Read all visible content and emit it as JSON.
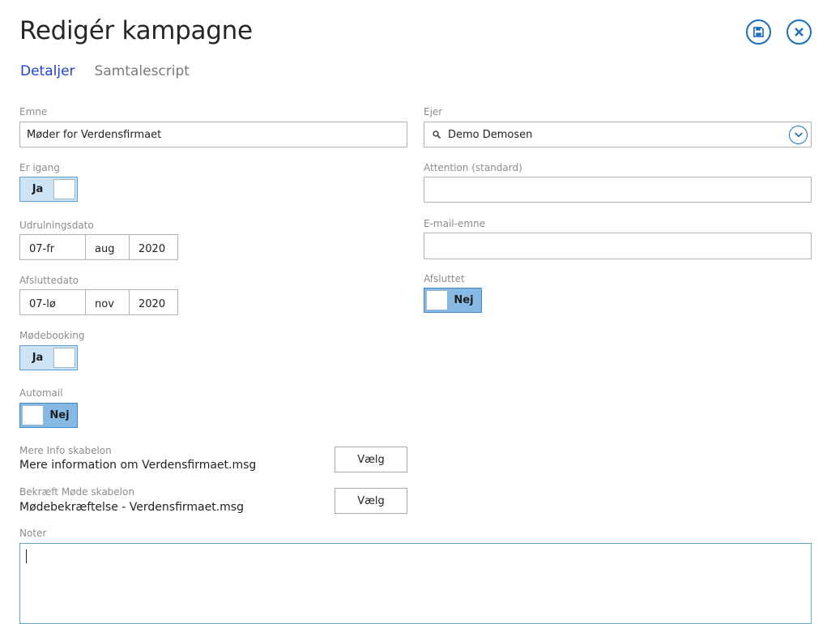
{
  "header": {
    "title": "Redigér kampagne",
    "save_icon": "save-icon",
    "close_icon": "close-icon"
  },
  "tabs": [
    {
      "label": "Detaljer",
      "active": true
    },
    {
      "label": "Samtalescript",
      "active": false
    }
  ],
  "form": {
    "emne": {
      "label": "Emne",
      "value": "Møder for Verdensfirmaet"
    },
    "ejer": {
      "label": "Ejer",
      "value": "Demo Demosen"
    },
    "er_igang": {
      "label": "Er igang",
      "value": "Ja",
      "state": "on"
    },
    "attention": {
      "label": "Attention (standard)",
      "value": ""
    },
    "udrulningsdato": {
      "label": "Udrulningsdato",
      "day": "07-fr",
      "month": "aug",
      "year": "2020"
    },
    "email_emne": {
      "label": "E-mail-emne",
      "value": ""
    },
    "afsluttedato": {
      "label": "Afsluttedato",
      "day": "07-lø",
      "month": "nov",
      "year": "2020"
    },
    "afsluttet": {
      "label": "Afsluttet",
      "value": "Nej",
      "state": "off"
    },
    "modebooking": {
      "label": "Mødebooking",
      "value": "Ja",
      "state": "on"
    },
    "automail": {
      "label": "Automail",
      "value": "Nej",
      "state": "off"
    },
    "mere_info": {
      "label": "Mere Info skabelon",
      "file": "Mere information om Verdensfirmaet.msg",
      "button": "Vælg"
    },
    "bekraeft": {
      "label": "Bekræft Møde skabelon",
      "file": "Mødebekræftelse - Verdensfirmaet.msg",
      "button": "Vælg"
    },
    "noter": {
      "label": "Noter",
      "value": ""
    }
  },
  "colors": {
    "accent": "#1a6fbf",
    "active_tab": "#1f3fd8",
    "toggle_on": "#cde4f7",
    "toggle_off": "#86b9e4"
  }
}
